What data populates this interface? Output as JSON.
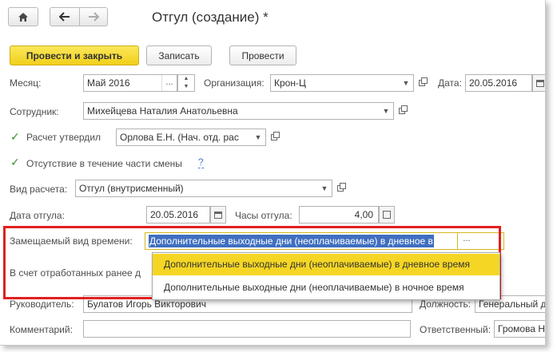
{
  "window": {
    "title": "Отгул (создание) *"
  },
  "toolbar": {
    "home_icon": "home-icon",
    "back_icon": "arrow-left-icon",
    "forward_icon": "arrow-right-icon",
    "post_close_label": "Провести и закрыть",
    "save_label": "Записать",
    "post_label": "Провести"
  },
  "form": {
    "month_label": "Месяц:",
    "month_value": "Май 2016",
    "org_label": "Организация:",
    "org_value": "Крон-Ц",
    "date_label": "Дата:",
    "date_value": "20.05.2016",
    "employee_label": "Сотрудник:",
    "employee_value": "Михейцева Наталия Анатольевна",
    "approved_label": "Расчет утвердил",
    "approved_value": "Орлова Е.Н. (Нач. отд. рас",
    "partial_absence_label": "Отсутствие в течение части смены",
    "help_label": "?",
    "calc_type_label": "Вид расчета:",
    "calc_type_value": "Отгул (внутрисменный)",
    "dayoff_date_label": "Дата отгула:",
    "dayoff_date_value": "20.05.2016",
    "hours_label": "Часы отгула:",
    "hours_value": "4,00",
    "replaced_type_label": "Замещаемый вид времени:",
    "replaced_type_value": "Дополнительные выходные дни (неоплачиваемые) в дневное в",
    "earlier_worked_label": "В счет отработанных ранее д",
    "manager_label": "Руководитель:",
    "manager_value": "Булатов Игорь Викторович",
    "position_label": "Должность:",
    "position_value": "Генеральный д",
    "comment_label": "Комментарий:",
    "comment_value": "",
    "responsible_label": "Ответственный:",
    "responsible_value": "Громова Н"
  },
  "dropdown": {
    "items": [
      "Дополнительные выходные дни (неоплачиваемые) в дневное время",
      "Дополнительные выходные дни (неоплачиваемые) в ночное время"
    ]
  },
  "colors": {
    "accent_yellow": "#f5d624",
    "highlight_red": "#e02020",
    "selection_blue": "#3f6fc0",
    "check_green": "#3a8e2f"
  }
}
